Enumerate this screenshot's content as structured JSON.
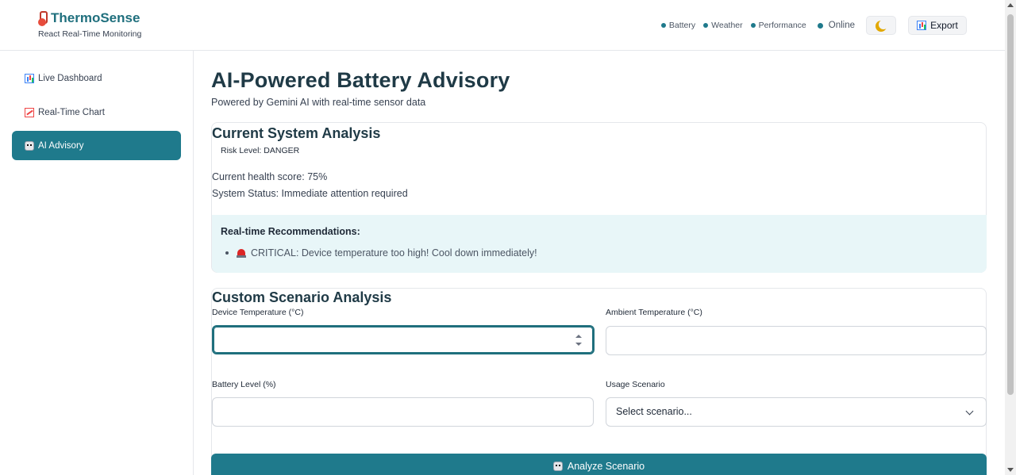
{
  "header": {
    "brand_title": "ThermoSense",
    "brand_subtitle": "React Real-Time Monitoring",
    "status_items": [
      "Battery",
      "Weather",
      "Performance"
    ],
    "online_label": "Online",
    "export_label": "Export",
    "status_color": "#1f7a8c"
  },
  "sidebar": {
    "items": [
      {
        "label": "Live Dashboard",
        "icon": "bar-chart-icon"
      },
      {
        "label": "Real-Time Chart",
        "icon": "trend-chart-icon"
      },
      {
        "label": "AI Advisory",
        "icon": "robot-icon",
        "active": true
      }
    ],
    "accent_color": "#1f7a8c"
  },
  "main": {
    "title": "AI-Powered Battery Advisory",
    "subtitle": "Powered by Gemini AI with real-time sensor data",
    "analysis": {
      "title": "Current System Analysis",
      "risk_level": "Risk Level: DANGER",
      "health_score": "Current health score: 75%",
      "system_status": "System Status: Immediate attention required",
      "recommendations_title": "Real-time Recommendations:",
      "recommendations": [
        "CRITICAL: Device temperature too high! Cool down immediately!"
      ]
    },
    "scenario": {
      "title": "Custom Scenario Analysis",
      "device_temp_label": "Device Temperature (°C)",
      "device_temp_value": "",
      "ambient_temp_label": "Ambient Temperature (°C)",
      "ambient_temp_value": "",
      "battery_level_label": "Battery Level (%)",
      "battery_level_value": "",
      "usage_scenario_label": "Usage Scenario",
      "usage_scenario_selected": "Select scenario...",
      "analyze_label": "Analyze Scenario"
    }
  }
}
